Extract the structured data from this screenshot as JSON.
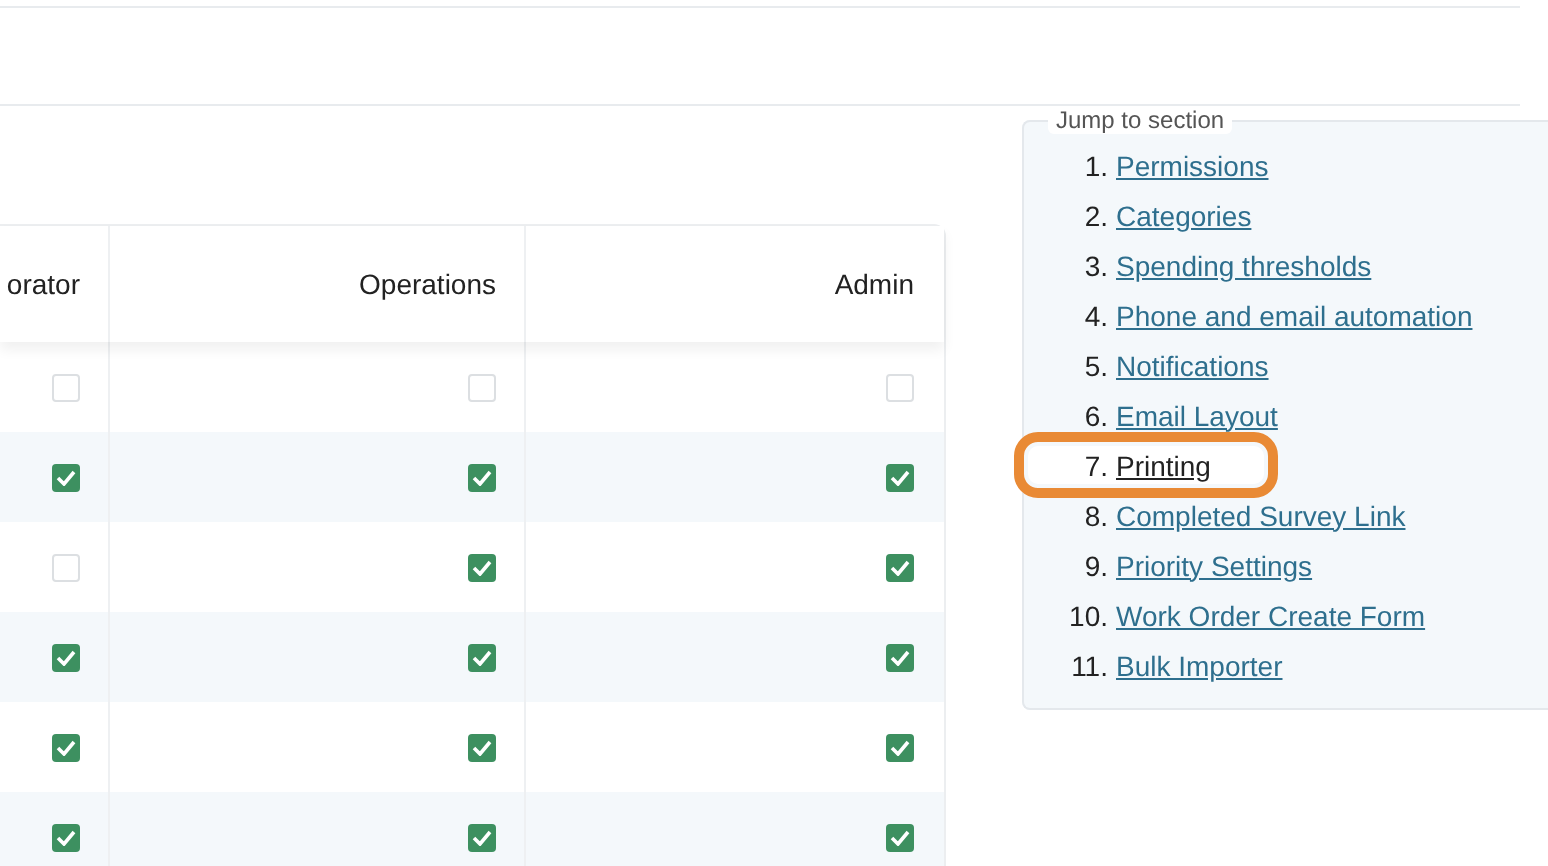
{
  "table": {
    "columns": [
      "orator",
      "Operations",
      "Admin"
    ],
    "rows": [
      {
        "cells": [
          {
            "checked": false
          },
          {
            "checked": false
          },
          {
            "checked": false
          }
        ]
      },
      {
        "cells": [
          {
            "checked": true
          },
          {
            "checked": true
          },
          {
            "checked": true
          }
        ]
      },
      {
        "cells": [
          {
            "checked": false
          },
          {
            "checked": true
          },
          {
            "checked": true
          }
        ]
      },
      {
        "cells": [
          {
            "checked": true
          },
          {
            "checked": true
          },
          {
            "checked": true
          }
        ]
      },
      {
        "cells": [
          {
            "checked": true
          },
          {
            "checked": true
          },
          {
            "checked": true
          }
        ]
      },
      {
        "cells": [
          {
            "checked": true
          },
          {
            "checked": true
          },
          {
            "checked": true
          }
        ]
      }
    ]
  },
  "jump_to_section": {
    "title": "Jump to section",
    "items": [
      {
        "number": "1.",
        "label": "Permissions",
        "highlighted": false
      },
      {
        "number": "2.",
        "label": "Categories",
        "highlighted": false
      },
      {
        "number": "3.",
        "label": "Spending thresholds",
        "highlighted": false
      },
      {
        "number": "4.",
        "label": "Phone and email automation",
        "highlighted": false
      },
      {
        "number": "5.",
        "label": "Notifications",
        "highlighted": false
      },
      {
        "number": "6.",
        "label": "Email Layout",
        "highlighted": false
      },
      {
        "number": "7.",
        "label": "Printing",
        "highlighted": true
      },
      {
        "number": "8.",
        "label": "Completed Survey Link",
        "highlighted": false
      },
      {
        "number": "9.",
        "label": "Priority Settings",
        "highlighted": false
      },
      {
        "number": "10.",
        "label": "Work Order Create Form",
        "highlighted": false
      },
      {
        "number": "11.",
        "label": "Bulk Importer",
        "highlighted": false
      }
    ]
  }
}
